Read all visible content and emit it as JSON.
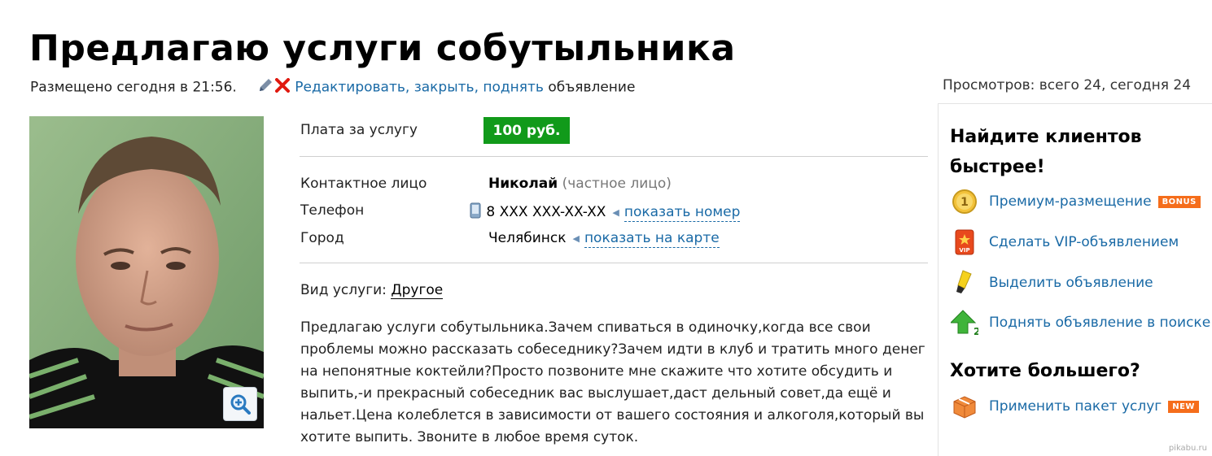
{
  "title": "Предлагаю услуги собутыльника",
  "meta": {
    "posted": "Размещено сегодня в 21:56.",
    "actions_link": "Редактировать, закрыть, поднять",
    "actions_suffix": "объявление"
  },
  "views": "Просмотров: всего 24, сегодня 24",
  "details": {
    "price_label": "Плата за услугу",
    "price_value": "100 руб.",
    "contact_label": "Контактное лицо",
    "contact_name": "Николай",
    "contact_type": "(частное лицо)",
    "phone_label": "Телефон",
    "phone_value": "8 XXX XXX-XX-XX",
    "phone_link": "показать номер",
    "city_label": "Город",
    "city_value": "Челябинск",
    "city_link": "показать на карте",
    "service_label": "Вид услуги:",
    "service_value": "Другое"
  },
  "description": "Предлагаю услуги собутыльника.Зачем спиваться в одиночку,когда все свои проблемы можно рассказать собеседнику?Зачем идти в клуб и тратить много денег на непонятные коктейли?Просто позвоните мне скажите что хотите обсудить и выпить,-и прекрасный собеседник вас выслушает,даст дельный совет,да ещё и нальет.Цена колеблется в зависимости от вашего состояния и алкоголя,который вы хотите выпить. Звоните в любое время суток.",
  "sidebar": {
    "heading1": "Найдите клиентов быстрее!",
    "items": [
      {
        "label": "Премиум-размещение",
        "tag": "BONUS",
        "icon": "gold-coin-icon"
      },
      {
        "label": "Сделать VIP-объявлением",
        "icon": "vip-icon"
      },
      {
        "label": "Выделить объявление",
        "icon": "highlighter-icon"
      },
      {
        "label": "Поднять объявление в поиске",
        "icon": "up-arrow-icon"
      }
    ],
    "heading2": "Хотите большего?",
    "package": {
      "label": "Применить пакет услуг",
      "tag": "NEW",
      "icon": "package-box-icon"
    }
  },
  "watermark": "pikabu.ru",
  "colors": {
    "link": "#1a6aa6",
    "price_badge": "#119a1a",
    "tag": "#f56d1b"
  }
}
